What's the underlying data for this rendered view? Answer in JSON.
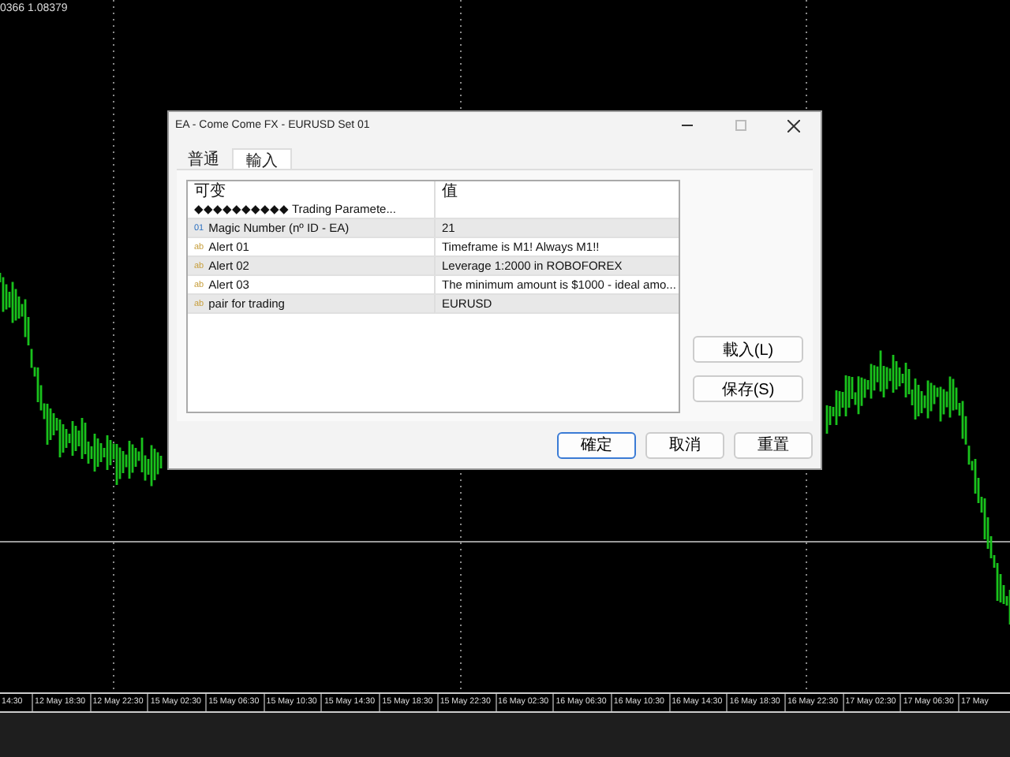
{
  "chart": {
    "price_label": "0366 1.08379",
    "time_labels": [
      "14:30",
      "12 May 18:30",
      "12 May 22:30",
      "15 May 02:30",
      "15 May 06:30",
      "15 May 10:30",
      "15 May 14:30",
      "15 May 18:30",
      "15 May 22:30",
      "16 May 02:30",
      "16 May 06:30",
      "16 May 10:30",
      "16 May 14:30",
      "16 May 18:30",
      "16 May 22:30",
      "17 May 02:30",
      "17 May 06:30",
      "17 May"
    ]
  },
  "window": {
    "title": "EA - Come Come FX - EURUSD Set 01"
  },
  "tabs": [
    {
      "label": "普通",
      "selected": false
    },
    {
      "label": "輸入",
      "selected": true
    }
  ],
  "table": {
    "columns": [
      "可变",
      "值"
    ],
    "rows": [
      {
        "kind": "separator",
        "name": "◆◆◆◆◆◆◆◆◆◆ Trading Paramete...",
        "value": ""
      },
      {
        "kind": "integer",
        "badge": "01",
        "name": "Magic Number (nº ID - EA)",
        "value": "21"
      },
      {
        "kind": "string",
        "badge": "ab",
        "name": "Alert 01",
        "value": "Timeframe is M1! Always M1!!"
      },
      {
        "kind": "string",
        "badge": "ab",
        "name": "Alert 02",
        "value": "Leverage 1:2000 in ROBOFOREX"
      },
      {
        "kind": "string",
        "badge": "ab",
        "name": "Alert 03",
        "value": "The minimum amount is $1000 - ideal amo..."
      },
      {
        "kind": "string",
        "badge": "ab",
        "name": "pair for trading",
        "value": "EURUSD"
      }
    ]
  },
  "side_buttons": [
    "載入(L)",
    "保存(S)"
  ],
  "buttons": [
    {
      "label": "確定",
      "default": true
    },
    {
      "label": "取消",
      "default": false
    },
    {
      "label": "重置",
      "default": false
    }
  ]
}
